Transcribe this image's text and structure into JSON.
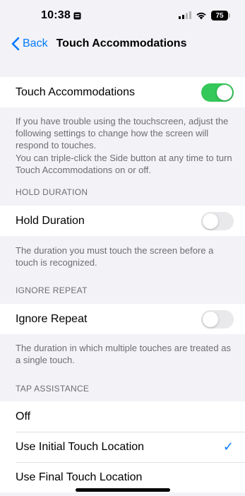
{
  "status_bar": {
    "time": "10:38",
    "battery": "75"
  },
  "nav": {
    "back_label": "Back",
    "title": "Touch Accommodations"
  },
  "touch_accommodations": {
    "label": "Touch Accommodations",
    "enabled": true,
    "footer_1": "If you have trouble using the touchscreen, adjust the following settings to change how the screen will respond to touches.",
    "footer_2": "You can triple-click the Side button at any time to turn Touch Accommodations on or off."
  },
  "hold_duration": {
    "header": "HOLD DURATION",
    "label": "Hold Duration",
    "enabled": false,
    "footer": "The duration you must touch the screen before a touch is recognized."
  },
  "ignore_repeat": {
    "header": "IGNORE REPEAT",
    "label": "Ignore Repeat",
    "enabled": false,
    "footer": "The duration in which multiple touches are treated as a single touch."
  },
  "tap_assistance": {
    "header": "TAP ASSISTANCE",
    "options": [
      {
        "label": "Off",
        "selected": false
      },
      {
        "label": "Use Initial Touch Location",
        "selected": true
      },
      {
        "label": "Use Final Touch Location",
        "selected": false
      }
    ]
  },
  "colors": {
    "accent": "#007aff",
    "toggle_on": "#34c759",
    "toggle_off": "#e9e9eb"
  }
}
